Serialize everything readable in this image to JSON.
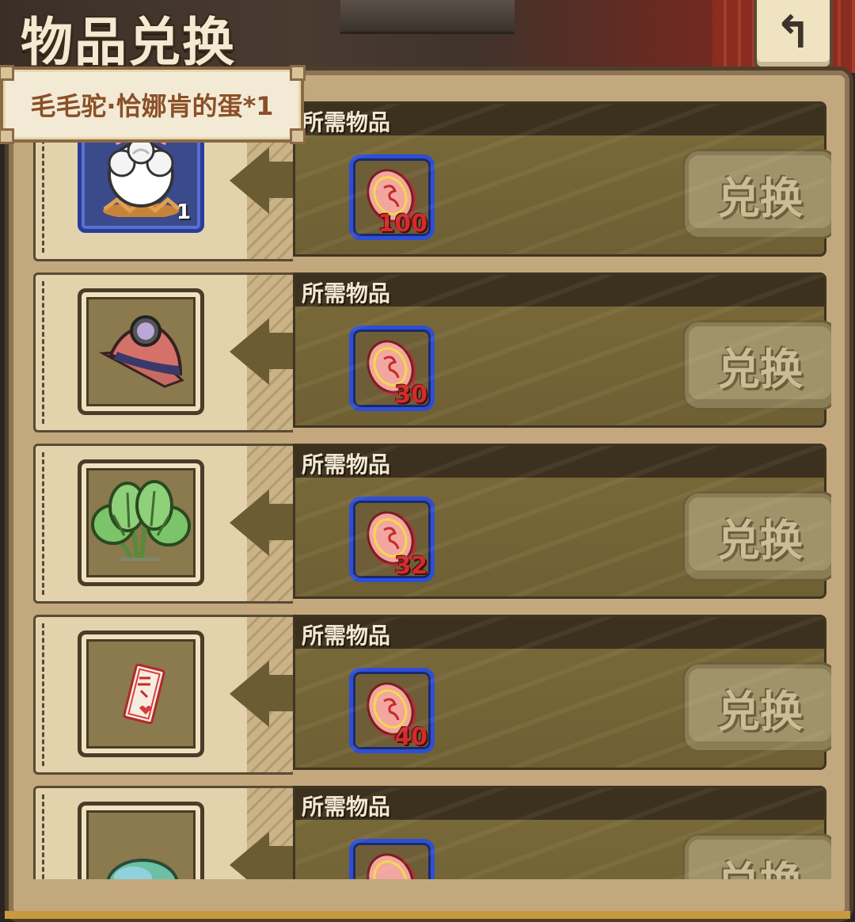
{
  "header": {
    "title": "物品兑换",
    "back_icon": "undo-arrow-icon"
  },
  "tooltip": {
    "text": "毛毛驼·恰娜肯的蛋*1"
  },
  "rows": [
    {
      "item_icon": "alpaca-egg-icon",
      "item_count": "1",
      "required_label": "所需物品",
      "cost_icon": "coin-token-icon",
      "cost": "100",
      "button_label": "兑换"
    },
    {
      "item_icon": "miner-helmet-icon",
      "item_count": "",
      "required_label": "所需物品",
      "cost_icon": "coin-token-icon",
      "cost": "30",
      "button_label": "兑换"
    },
    {
      "item_icon": "cabbage-icon",
      "item_count": "",
      "required_label": "所需物品",
      "cost_icon": "coin-token-icon",
      "cost": "32",
      "button_label": "兑换"
    },
    {
      "item_icon": "talisman-ticket-icon",
      "item_count": "",
      "required_label": "所需物品",
      "cost_icon": "coin-token-icon",
      "cost": "40",
      "button_label": "兑换"
    },
    {
      "item_icon": "leaf-icon",
      "item_count": "",
      "required_label": "所需物品",
      "cost_icon": "coin-token-icon",
      "cost": "",
      "button_label": "兑换"
    }
  ]
}
